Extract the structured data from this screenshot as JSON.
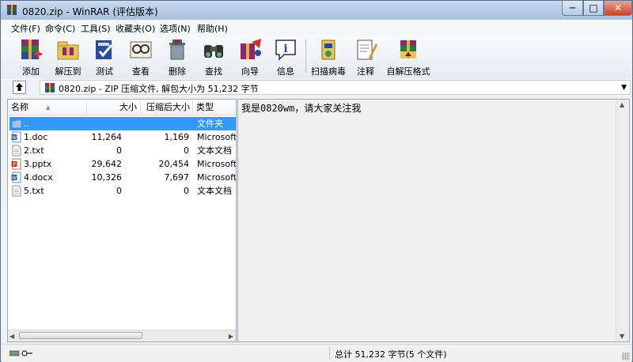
{
  "window": {
    "title": "0820.zip - WinRAR (评估版本)",
    "controls": {
      "minimize": "─",
      "maximize": "□",
      "close": "✕"
    }
  },
  "menu": [
    "文件(F)",
    "命令(C)",
    "工具(S)",
    "收藏夹(O)",
    "选项(N)",
    "帮助(H)"
  ],
  "toolbar": [
    {
      "label": "添加",
      "icon": "add-archive-icon"
    },
    {
      "label": "解压到",
      "icon": "extract-to-icon"
    },
    {
      "label": "测试",
      "icon": "test-icon"
    },
    {
      "label": "查看",
      "icon": "view-icon"
    },
    {
      "label": "删除",
      "icon": "delete-icon"
    },
    {
      "label": "查找",
      "icon": "find-icon"
    },
    {
      "label": "向导",
      "icon": "wizard-icon"
    },
    {
      "label": "信息",
      "icon": "info-icon"
    },
    {
      "label": "扫描病毒",
      "icon": "virus-scan-icon"
    },
    {
      "label": "注释",
      "icon": "comment-icon"
    },
    {
      "label": "自解压格式",
      "icon": "sfx-icon"
    }
  ],
  "address": {
    "path": "0820.zip - ZIP 压缩文件, 解包大小为 51,232 字节"
  },
  "columns": {
    "name": "名称",
    "size": "大小",
    "packed": "压缩后大小",
    "type": "类型"
  },
  "files": [
    {
      "name": "..",
      "size": "",
      "packed": "",
      "type": "文件夹",
      "icon": "folder-icon",
      "selected": true
    },
    {
      "name": "1.doc",
      "size": "11,264",
      "packed": "1,169",
      "type": "Microsoft",
      "icon": "word-doc-icon",
      "selected": false
    },
    {
      "name": "2.txt",
      "size": "0",
      "packed": "0",
      "type": "文本文档",
      "icon": "text-file-icon",
      "selected": false
    },
    {
      "name": "3.pptx",
      "size": "29,642",
      "packed": "20,454",
      "type": "Microsoft",
      "icon": "powerpoint-icon",
      "selected": false
    },
    {
      "name": "4.docx",
      "size": "10,326",
      "packed": "7,697",
      "type": "Microsoft",
      "icon": "word-docx-icon",
      "selected": false
    },
    {
      "name": "5.txt",
      "size": "0",
      "packed": "0",
      "type": "文本文档",
      "icon": "text-file-icon",
      "selected": false
    }
  ],
  "comment": "我是0820wm，请大家关注我",
  "status": "总计 51,232 字节(5 个文件)",
  "colors": {
    "selection": "#3399ff",
    "titlebar": "#b9cde8"
  }
}
